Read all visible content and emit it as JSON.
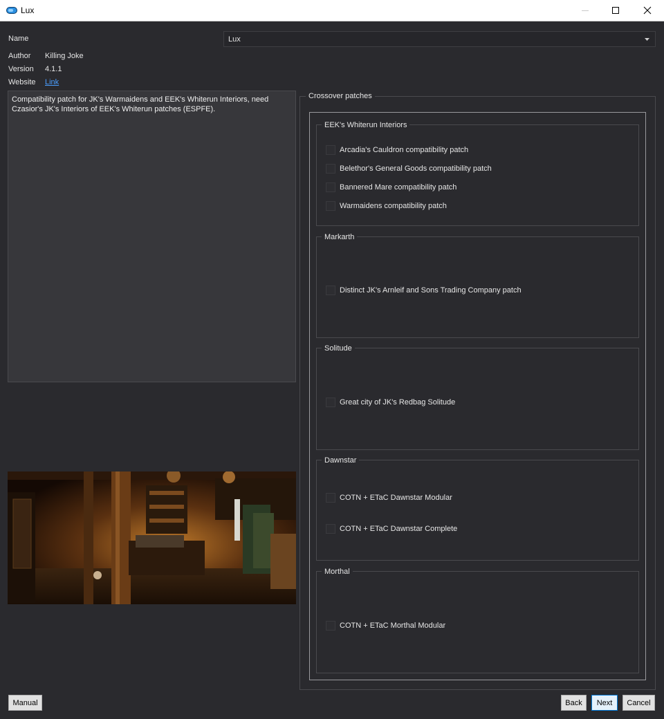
{
  "window": {
    "title": "Lux",
    "icon": "lux-app-icon",
    "controls": [
      "minimize-icon",
      "maximize-icon",
      "close-icon"
    ]
  },
  "info": {
    "name_label": "Name",
    "name_value": "Lux",
    "author_label": "Author",
    "author_value": "Killing Joke",
    "version_label": "Version",
    "version_value": "4.1.1",
    "website_label": "Website",
    "website_link": "Link"
  },
  "description": "Compatibility patch for JK's Warmaidens and EEK's Whiterun Interiors, need Czasior's JK's Interiors of EEK's Whiterun patches (ESPFE).",
  "crossover": {
    "title": "Crossover patches",
    "groups": [
      {
        "title": "EEK's Whiterun Interiors",
        "options": [
          {
            "label": "Arcadia's Cauldron compatibility patch",
            "checked": false
          },
          {
            "label": "Belethor's General Goods compatibility patch",
            "checked": false
          },
          {
            "label": "Bannered Mare compatibility patch",
            "checked": false
          },
          {
            "label": "Warmaidens compatibility patch",
            "checked": false
          }
        ]
      },
      {
        "title": "Markarth",
        "options": [
          {
            "label": "Distinct JK's Arnleif and Sons Trading Company patch",
            "checked": false
          }
        ]
      },
      {
        "title": "Solitude",
        "options": [
          {
            "label": "Great city of JK's Redbag Solitude",
            "checked": false
          }
        ]
      },
      {
        "title": "Dawnstar",
        "options": [
          {
            "label": "COTN + ETaC Dawnstar Modular",
            "checked": false
          },
          {
            "label": "COTN + ETaC Dawnstar Complete",
            "checked": false
          }
        ]
      },
      {
        "title": "Morthal",
        "options": [
          {
            "label": "COTN + ETaC Morthal Modular",
            "checked": false
          }
        ]
      }
    ]
  },
  "buttons": {
    "manual": "Manual",
    "back": "Back",
    "next": "Next",
    "cancel": "Cancel"
  },
  "colors": {
    "background": "#2a2a2e",
    "link": "#4a9eff",
    "accent": "#0078d7"
  }
}
